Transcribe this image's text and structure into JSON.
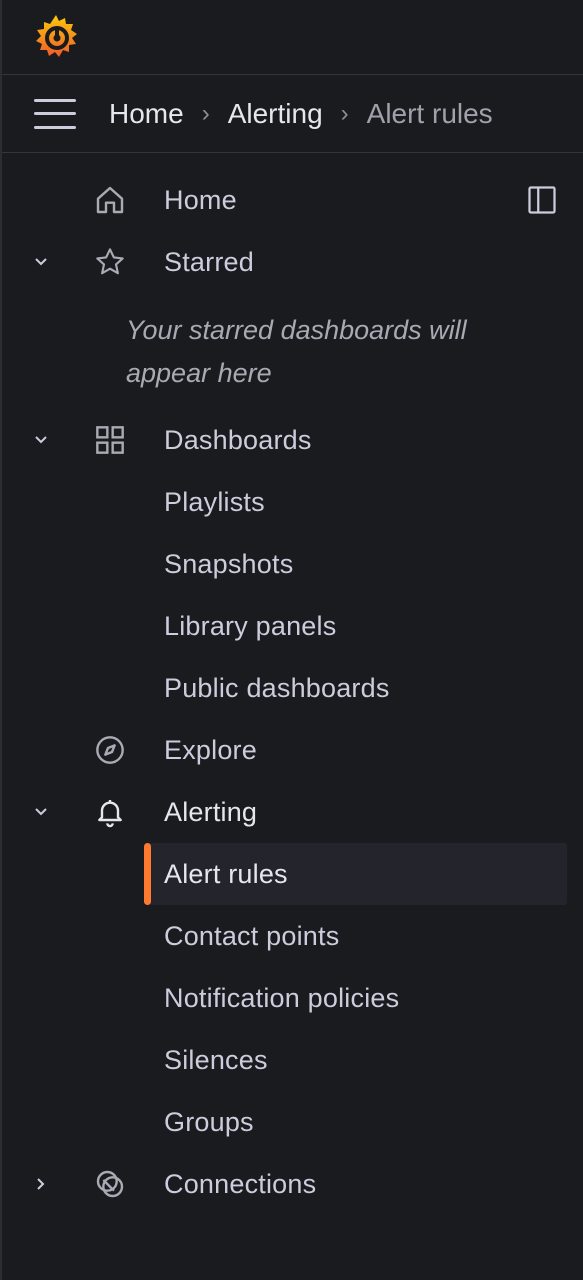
{
  "breadcrumb": {
    "items": [
      "Home",
      "Alerting",
      "Alert rules"
    ]
  },
  "nav": {
    "home": "Home",
    "starred": "Starred",
    "starred_empty": "Your starred dashboards will appear here",
    "dashboards": "Dashboards",
    "playlists": "Playlists",
    "snapshots": "Snapshots",
    "library_panels": "Library panels",
    "public_dashboards": "Public dashboards",
    "explore": "Explore",
    "alerting": "Alerting",
    "alert_rules": "Alert rules",
    "contact_points": "Contact points",
    "notification_policies": "Notification policies",
    "silences": "Silences",
    "groups": "Groups",
    "connections": "Connections"
  },
  "icons": {
    "logo": "grafana-logo",
    "menu": "hamburger-icon",
    "home": "home-icon",
    "starred": "star-icon",
    "dashboards": "grid-icon",
    "explore": "compass-icon",
    "alerting": "bell-icon",
    "connections": "connections-icon",
    "dock": "dock-panel-icon"
  },
  "colors": {
    "accent": "#ff7a2f",
    "background": "#1a1b1f",
    "active_background": "#24252c"
  }
}
